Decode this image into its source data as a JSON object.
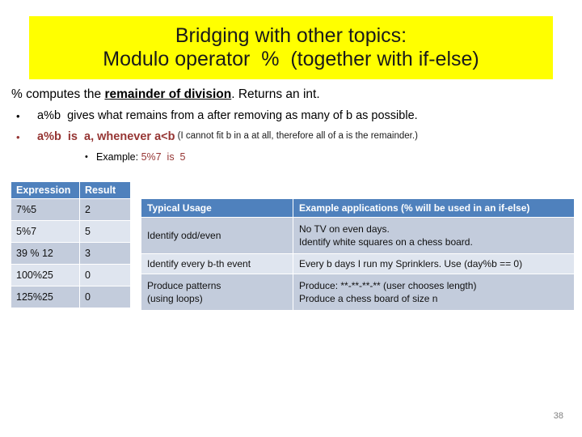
{
  "title": {
    "line1": "Bridging with other topics:",
    "line2": "Modulo operator  %  (together with if-else)",
    "background_color": "#ffff00"
  },
  "body": {
    "intro": {
      "prefix": "% computes the ",
      "emphasis": "remainder of division",
      "suffix": ". Returns an int."
    },
    "bullets": [
      {
        "level": 1,
        "marker": "•",
        "text": "a%b  gives what remains from a after removing as many of b as possible.",
        "color": "#000000"
      },
      {
        "level": 1,
        "marker": "•",
        "text": "a%b  is  a, whenever a<b",
        "note": "(I cannot fit b in a at all, therefore all of a is the remainder.)",
        "color": "#963634"
      },
      {
        "level": 2,
        "marker": "•",
        "label": "Example: ",
        "text": "5%7  is  5",
        "color": "#963634"
      }
    ]
  },
  "expression_table": {
    "headers": [
      "Expression",
      "Result"
    ],
    "rows": [
      [
        "7%5",
        "2"
      ],
      [
        "5%7",
        "5"
      ],
      [
        "39 % 12",
        "3"
      ],
      [
        "100%25",
        "0"
      ],
      [
        "125%25",
        "0"
      ]
    ]
  },
  "usage_table": {
    "headers": [
      "Typical Usage",
      "Example applications (% will be used in an if-else)"
    ],
    "rows": [
      {
        "usage": "Identify odd/even",
        "examples": "No TV on even days.\nIdentify white squares  on a chess board."
      },
      {
        "usage": "Identify every b-th event",
        "examples": "Every b days I run my Sprinklers.   Use  (day%b == 0)"
      },
      {
        "usage": "Produce patterns\n(using loops)",
        "examples": "Produce:  **-**-**-**     (user chooses length)\nProduce a chess board of size n"
      }
    ]
  },
  "page_number": "38",
  "colors": {
    "header_blue": "#4f81bd",
    "band_dark": "#c3ccdc",
    "band_light": "#dfe5ef",
    "accent_red": "#963634",
    "banner_yellow": "#ffff00"
  }
}
